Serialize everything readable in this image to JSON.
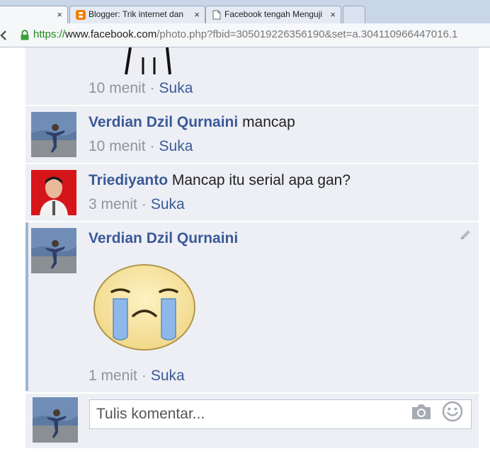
{
  "browser": {
    "tabs": [
      {
        "title": "",
        "active": true
      },
      {
        "title": "Blogger: Trik internet dan",
        "active": false
      },
      {
        "title": "Facebook tengah Menguji",
        "active": false
      }
    ],
    "close_glyph": "×",
    "url": {
      "scheme": "https://",
      "host": "www.facebook.com",
      "path": "/photo.php?fbid=305019226356190&set=a.304110966447016.1"
    }
  },
  "comments": [
    {
      "name": "",
      "text": "",
      "time": "10 menit",
      "like": "Suka",
      "sticker": "stick-figure"
    },
    {
      "name": "Verdian Dzil Qurnaini",
      "text": "mancap",
      "time": "10 menit",
      "like": "Suka"
    },
    {
      "name": "Triediyanto",
      "text": "Mancap itu serial apa gan?",
      "time": "3 menit",
      "like": "Suka"
    },
    {
      "name": "Verdian Dzil Qurnaini",
      "text": "",
      "time": "1 menit",
      "like": "Suka",
      "sticker": "crying-face"
    }
  ],
  "separator": "·",
  "composer": {
    "placeholder": "Tulis komentar..."
  },
  "colors": {
    "link": "#3b5998",
    "meta": "#90949c",
    "panel": "#edeff4",
    "highlight": "#9cb4d8"
  }
}
